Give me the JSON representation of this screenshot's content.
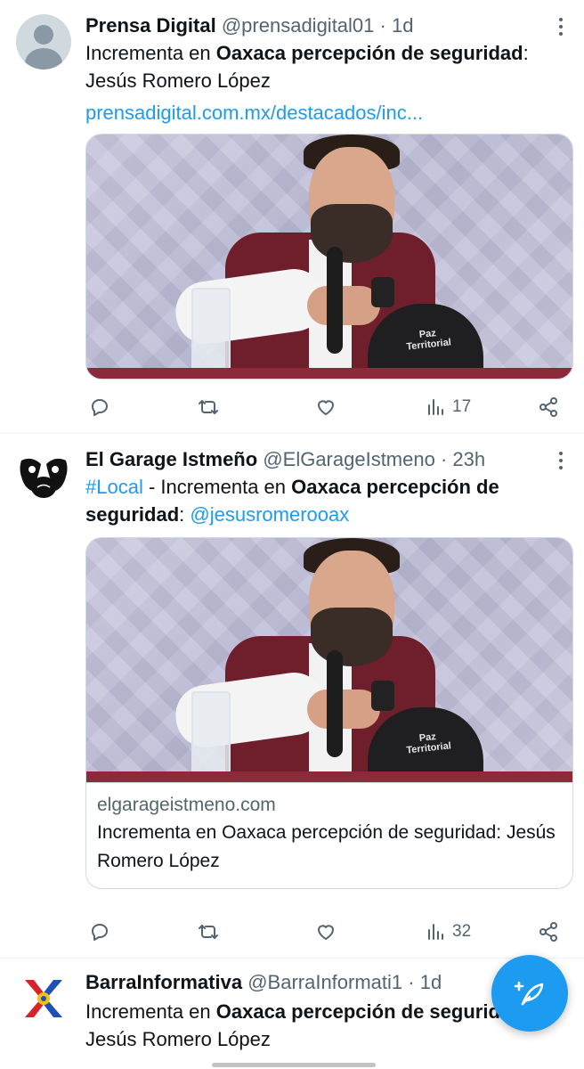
{
  "tweets": [
    {
      "name": "Prensa Digital",
      "handle": "@prensadigital01",
      "dot": "·",
      "time": "1d",
      "text": {
        "part1": "Incrementa en ",
        "bold1": "Oaxaca percepción de seguridad",
        "part2": ": Jesús Romero López"
      },
      "link": "prensadigital.com.mx/destacados/inc...",
      "image": {
        "cap_text": "Paz Territorial"
      },
      "actions": {
        "views": "17"
      },
      "avatar_icon": "default-avatar-icon"
    },
    {
      "name": "El Garage Istmeño",
      "handle": "@ElGarageIstmeno",
      "dot": "·",
      "time": "23h",
      "text": {
        "hashtag": "#Local",
        "part1": " - Incrementa en ",
        "bold1": "Oaxaca percepción de seguridad",
        "part2": ": ",
        "mention": "@jesusromerooax"
      },
      "image": {
        "cap_text": "Paz Territorial"
      },
      "card": {
        "domain": "elgarageistmeno.com",
        "title": "Incrementa en Oaxaca percepción de seguridad: Jesús Romero López"
      },
      "actions": {
        "views": "32"
      },
      "avatar_icon": "garage-logo-icon"
    },
    {
      "name": "BarraInformativa",
      "handle": "@BarraInformati1",
      "dot": "·",
      "time": "1d",
      "text": {
        "part1": "Incrementa en ",
        "bold1": "Oaxaca percepción de seguridad",
        "part2": ": Jesús Romero López"
      },
      "avatar_icon": "barra-logo-icon"
    }
  ],
  "colors": {
    "accent": "#1d9bf0",
    "text": "#0f1419",
    "secondary": "#536471",
    "divider": "#eff3f4"
  },
  "fab": {
    "icon": "compose-feather-plus-icon"
  }
}
